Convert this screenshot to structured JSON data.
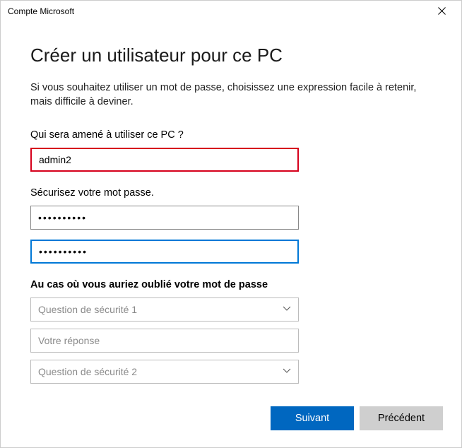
{
  "window": {
    "title": "Compte Microsoft"
  },
  "heading": "Créer un utilisateur pour ce PC",
  "intro": "Si vous souhaitez utiliser un mot de passe, choisissez une expression facile à retenir, mais difficile à deviner.",
  "user_section": {
    "label": "Qui sera amené à utiliser ce PC ?",
    "username_value": "admin2"
  },
  "password_section": {
    "label": "Sécurisez votre mot passe.",
    "pw1_value": "••••••••••",
    "pw2_value": "••••••••••"
  },
  "forgot_section": {
    "label": "Au cas où vous auriez oublié votre mot de passe",
    "question1_placeholder": "Question de sécurité 1",
    "answer_placeholder": "Votre réponse",
    "question2_placeholder": "Question de sécurité 2"
  },
  "buttons": {
    "next": "Suivant",
    "back": "Précédent"
  }
}
